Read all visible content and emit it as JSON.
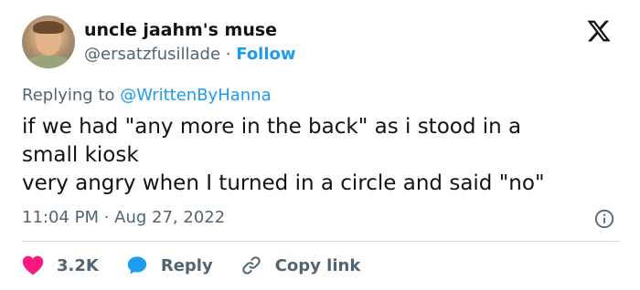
{
  "author": {
    "display_name": "uncle jaahm's muse",
    "handle": "@ersatzfusillade",
    "separator": "·",
    "follow_label": "Follow",
    "avatar_icon": "profile-photo"
  },
  "brand": {
    "logo_icon": "x-logo"
  },
  "reply_context": {
    "prefix": "Replying to",
    "mention": "@WrittenByHanna"
  },
  "tweet": {
    "lines": [
      "if we had \"any more in the back\" as i stood in a",
      "small kiosk",
      "very angry when I turned in a circle and said \"no\""
    ],
    "timestamp": "11:04 PM · Aug 27, 2022",
    "info_icon": "info-icon"
  },
  "actions": {
    "like_count": "3.2K",
    "reply_label": "Reply",
    "copy_label": "Copy link",
    "like_icon": "heart-icon",
    "reply_icon": "speech-bubble-icon",
    "copy_icon": "link-icon"
  },
  "colors": {
    "accent": "#1d9bf0",
    "like": "#f91880",
    "text": "#0f1419",
    "muted": "#536471",
    "divider": "#cfd9de"
  }
}
